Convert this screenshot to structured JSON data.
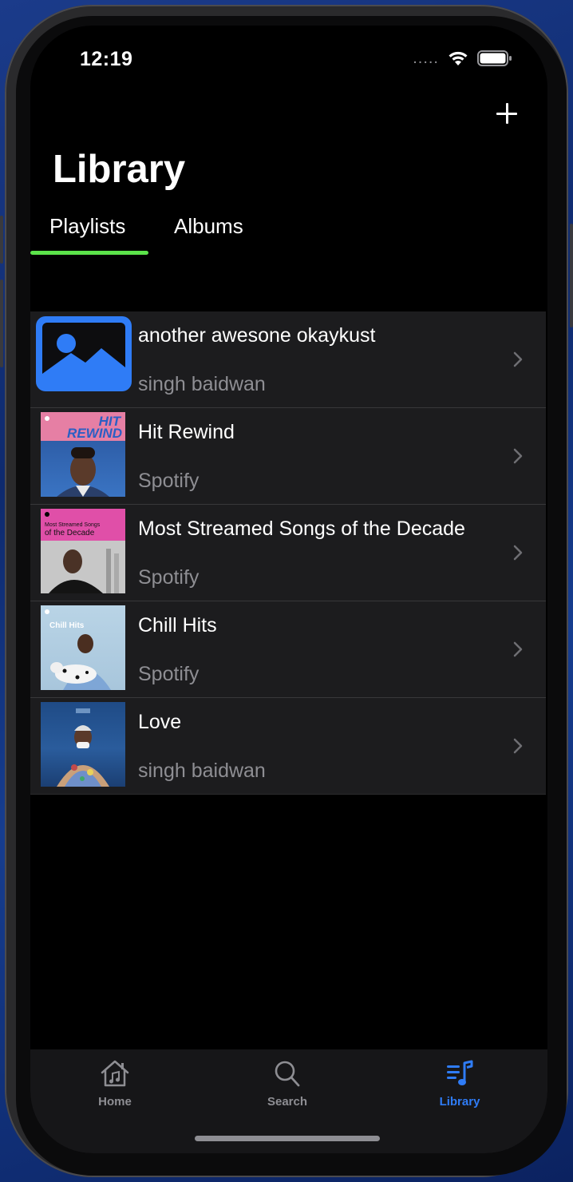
{
  "status": {
    "time": "12:19",
    "signal_glyph": "....."
  },
  "header": {
    "title": "Library",
    "add_icon": "plus-icon"
  },
  "tabs": [
    {
      "label": "Playlists",
      "selected": true
    },
    {
      "label": "Albums",
      "selected": false
    }
  ],
  "colors": {
    "accent_green": "#5be34a",
    "accent_blue": "#2f7cf6",
    "row_bg": "#1c1c1e",
    "secondary_text": "#8e8e93"
  },
  "playlists": [
    {
      "title": "another awesone okaykust",
      "owner": "singh baidwan",
      "art": "placeholder-image-icon"
    },
    {
      "title": "Hit Rewind",
      "owner": "Spotify",
      "art": "hit-rewind-cover",
      "cover_text": [
        "HIT",
        "REWIND"
      ]
    },
    {
      "title": "Most Streamed Songs of the Decade",
      "owner": "Spotify",
      "art": "most-streamed-cover",
      "cover_text": [
        "Most Streamed Songs",
        "of the Decade"
      ]
    },
    {
      "title": "Chill Hits",
      "owner": "Spotify",
      "art": "chill-hits-cover",
      "cover_text": [
        "Chill Hits"
      ]
    },
    {
      "title": "Love",
      "owner": "singh baidwan",
      "art": "love-cover"
    }
  ],
  "tabbar": [
    {
      "label": "Home",
      "icon": "home-music-icon",
      "active": false
    },
    {
      "label": "Search",
      "icon": "search-icon",
      "active": false
    },
    {
      "label": "Library",
      "icon": "library-music-icon",
      "active": true
    }
  ]
}
